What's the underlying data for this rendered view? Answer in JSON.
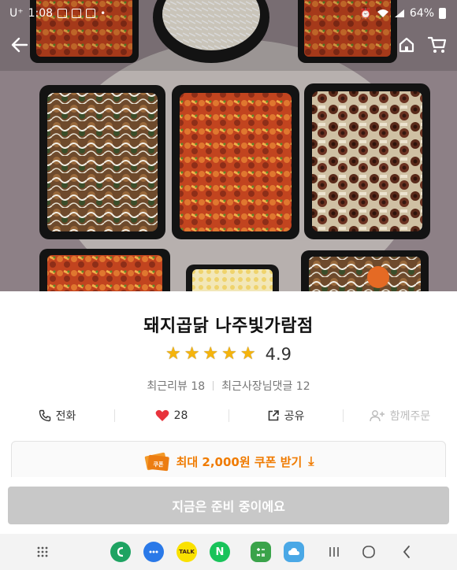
{
  "status_bar": {
    "carrier": "U⁺",
    "time": "1:08",
    "battery": "64%"
  },
  "nav": {
    "back_icon": "back-arrow-icon",
    "home_icon": "home-icon",
    "cart_icon": "cart-icon"
  },
  "shop": {
    "name": "돼지곱닭 나주빛가람점",
    "rating": "4.9",
    "stars": 5,
    "recent_reviews_label": "최근리뷰 18",
    "owner_replies_label": "최근사장님댓글 12"
  },
  "actions": {
    "call_label": "전화",
    "likes_count": "28",
    "share_label": "공유",
    "group_order_label": "함께주문"
  },
  "coupon": {
    "label": "최대 2,000원 쿠폰 받기",
    "badge_text": "쿠폰"
  },
  "order": {
    "button_label": "지금은 준비 중이에요"
  },
  "dock": {
    "apps": [
      "phone-app",
      "messages-app",
      "kakaotalk-app",
      "naver-app",
      "calculator-app",
      "cloud-app"
    ],
    "kakao_label": "TALK",
    "naver_label": "N"
  },
  "colors": {
    "accent_orange": "#f07b00",
    "star_yellow": "#f5b40c",
    "heart_red": "#e8333c",
    "disabled_button": "#c8c8c8"
  }
}
